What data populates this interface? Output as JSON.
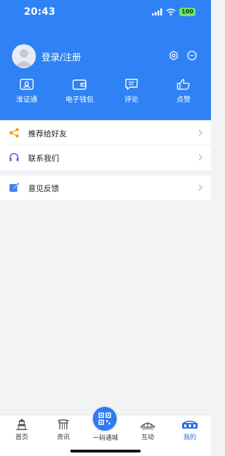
{
  "status": {
    "time": "20:43",
    "battery": "100"
  },
  "profile": {
    "login_label": "登录/注册"
  },
  "quick_actions": [
    {
      "label": "淮证通",
      "icon": "id-card-icon"
    },
    {
      "label": "电子钱包",
      "icon": "wallet-icon"
    },
    {
      "label": "评论",
      "icon": "comment-icon"
    },
    {
      "label": "点赞",
      "icon": "thumbs-up-icon"
    }
  ],
  "menu": {
    "group1": [
      {
        "label": "推荐给好友",
        "icon": "share-icon"
      },
      {
        "label": "联系我们",
        "icon": "headset-icon"
      }
    ],
    "group2": [
      {
        "label": "意见反馈",
        "icon": "feedback-icon"
      }
    ]
  },
  "tabbar": {
    "items": [
      {
        "label": "首页",
        "icon": "pagoda-icon"
      },
      {
        "label": "资讯",
        "icon": "gate-icon"
      },
      {
        "label": "一码通城",
        "icon": "qr-code-icon"
      },
      {
        "label": "互动",
        "icon": "bridge-icon"
      },
      {
        "label": "我的",
        "icon": "building-icon"
      }
    ],
    "active": "我的"
  },
  "colors": {
    "brand_blue": "#2f82f5",
    "active_tab": "#2a6fe0"
  }
}
